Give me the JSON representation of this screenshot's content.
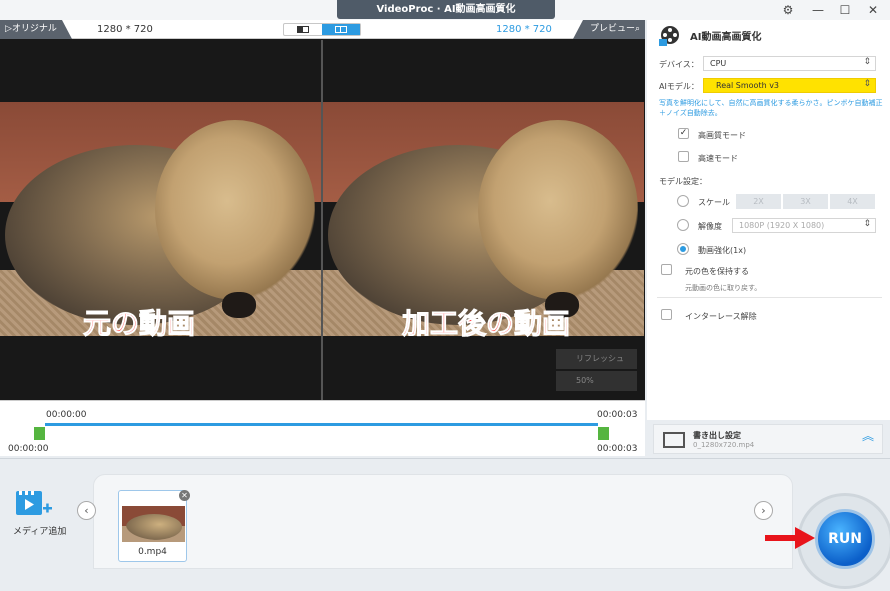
{
  "window": {
    "title": "VideoProc · AI動画高画質化"
  },
  "preview": {
    "left_tab": "▷オリジナル",
    "right_tab": "プレビュー⌕",
    "left_resolution": "1280 * 720",
    "right_resolution": "1280 * 720",
    "overlay_left": "元の動画",
    "overlay_right": "加工後の動画",
    "refresh_label": "リフレッシュ",
    "zoom_label": "50%"
  },
  "timeline": {
    "start_top": "00:00:00",
    "end_top": "00:00:03",
    "start_bottom": "00:00:00",
    "end_bottom": "00:00:03"
  },
  "panel": {
    "title": "AI動画高画質化",
    "device_label": "デバイス：",
    "device_value": "CPU",
    "model_label": "AIモデル：",
    "model_value": "Real Smooth v3",
    "model_note": "写真を鮮明化にして、自然に高画質化する柔らかさ。ピンボケ自動補正＋ノイズ自動除去。",
    "high_quality_mode": "高画質モード",
    "high_quality_checked": true,
    "high_speed_mode": "高速モード",
    "high_speed_checked": false,
    "model_settings_label": "モデル設定：",
    "scale_label": "スケール",
    "scale_options": [
      "2X",
      "3X",
      "4X"
    ],
    "resolution_label": "解像度",
    "resolution_value": "1080P (1920 X 1080)",
    "enhance_label": "動画強化(1x)",
    "selected_model_setting": "enhance",
    "keep_color_label": "元の色を保持する",
    "keep_color_note": "元動画の色に取り戻す。",
    "keep_color_checked": false,
    "deinterlace_label": "インターレース解除",
    "deinterlace_checked": false
  },
  "export": {
    "title": "書き出し設定",
    "filename": "0_1280x720.mp4"
  },
  "media": {
    "add_label": "メディア追加",
    "items": [
      {
        "filename": "0.mp4"
      }
    ]
  },
  "run": {
    "label": "RUN"
  },
  "colors": {
    "accent": "#2d9be1",
    "overlay_text": "#ff2a2a",
    "model_highlight": "#ffe200",
    "run_button": "#0b5fc9",
    "timeline_handle": "#55b540"
  }
}
